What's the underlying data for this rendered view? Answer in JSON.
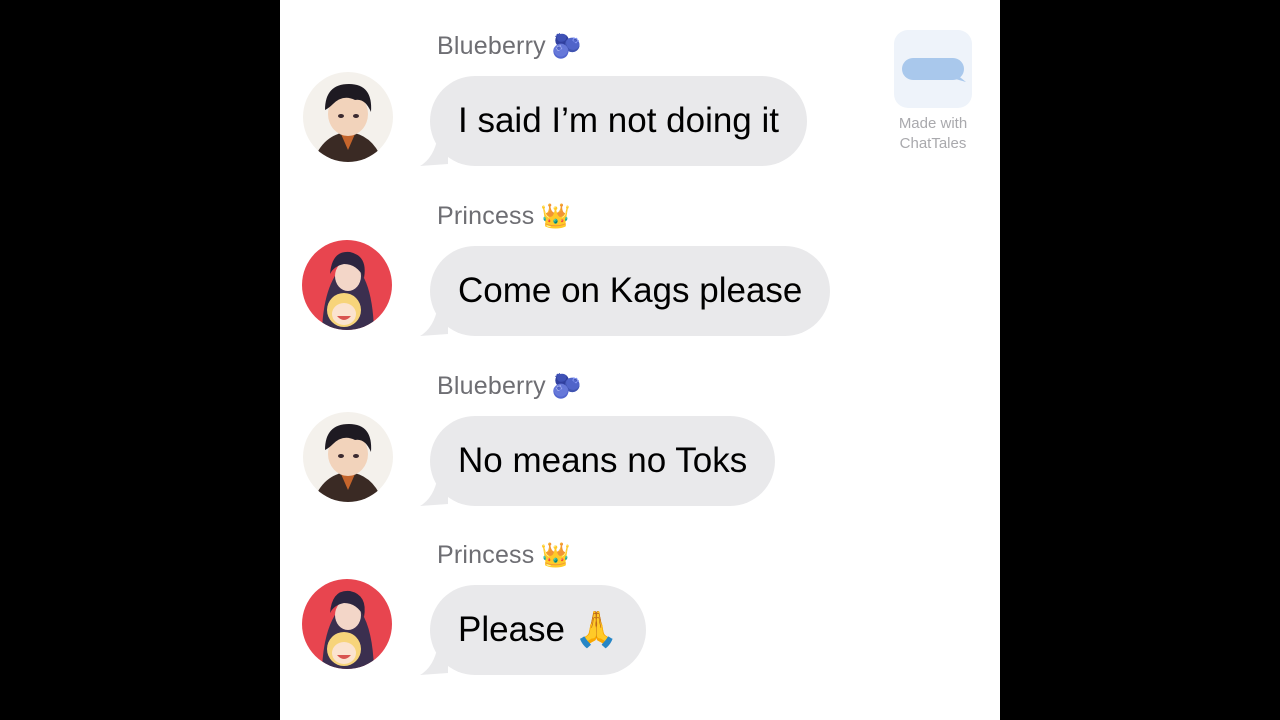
{
  "watermark": {
    "line1": "Made with",
    "line2": "ChatTales"
  },
  "messages": [
    {
      "sender": "Blueberry",
      "sender_emoji": "🫐",
      "text": "I said I’m not doing it",
      "avatar": "blueberry"
    },
    {
      "sender": "Princess",
      "sender_emoji": "👑",
      "text": "Come on Kags please",
      "avatar": "princess"
    },
    {
      "sender": "Blueberry",
      "sender_emoji": "🫐",
      "text": "No means no Toks",
      "avatar": "blueberry"
    },
    {
      "sender": "Princess",
      "sender_emoji": "👑",
      "text": "Please 🙏",
      "avatar": "princess"
    }
  ],
  "colors": {
    "bubble": "#e9e9eb",
    "sender_text": "#6e6e73",
    "princess_avatar_bg": "#e8454f"
  }
}
